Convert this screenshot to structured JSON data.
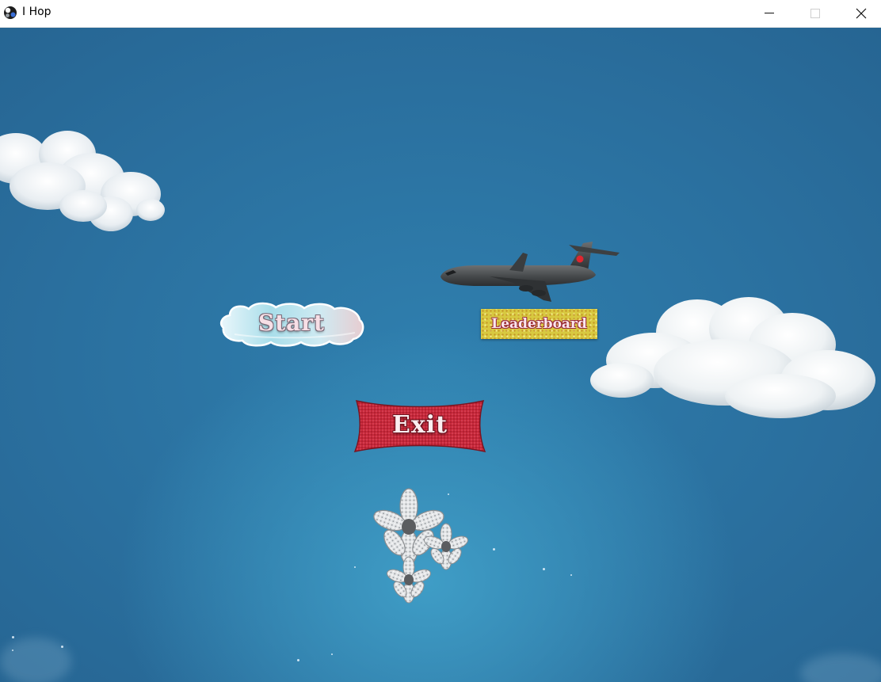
{
  "window": {
    "title": "I Hop",
    "minimize_icon": "minimize-icon",
    "maximize_icon": "maximize-icon",
    "close_icon": "close-icon"
  },
  "menu": {
    "start_label": "Start",
    "leaderboard_label": "Leaderboard",
    "exit_label": "Exit"
  },
  "colors": {
    "sky": "#2a6f9e",
    "start_button": "#bfe3ee",
    "leaderboard_button": "#d8c940",
    "exit_button": "#c8283a"
  }
}
